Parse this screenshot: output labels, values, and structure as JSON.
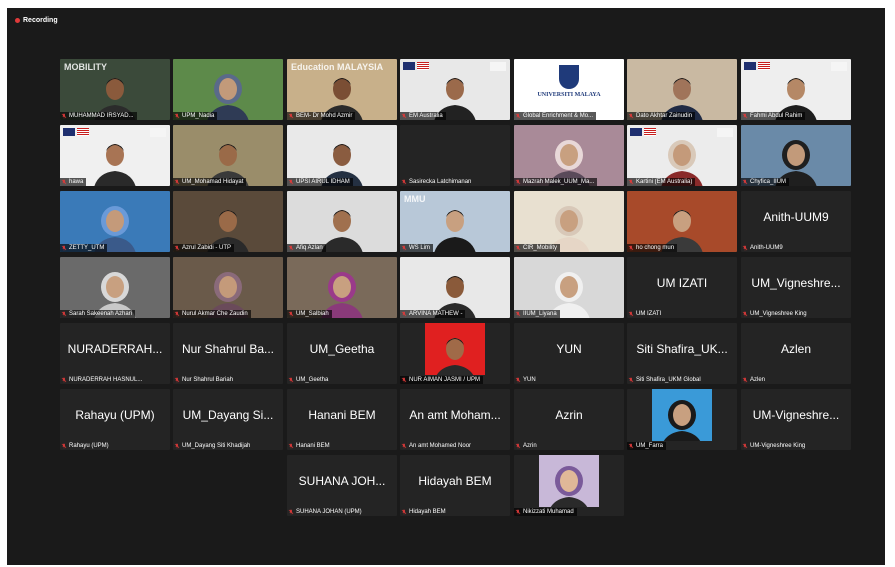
{
  "recording": {
    "label": "Recording",
    "color": "#e03a3a"
  },
  "colors": {
    "window_bg": "#1a1a1a",
    "tile_bg": "#242424",
    "muted_mic": "#e03a3a"
  },
  "participants": [
    {
      "name": "MUHAMMAD IRSYAD...",
      "display": "",
      "row": 0,
      "col": 0,
      "video": "banner",
      "bg": "#3b4a3a",
      "skin": "#8a5a3c",
      "shirt": "#2b2b2b",
      "icon": "pin-icon",
      "overlay": "MOBILITY"
    },
    {
      "name": "UPM_Nadia",
      "display": "",
      "row": 0,
      "col": 1,
      "video": "cam",
      "bg": "#5d8a4a",
      "skin": "#c29a7a",
      "shirt": "#2f3b55",
      "scarf": "#5a6a8a"
    },
    {
      "name": "BEM- Dr Mohd Azmir",
      "display": "",
      "row": 0,
      "col": 2,
      "video": "banner",
      "bg": "#c8b08a",
      "skin": "#7a4e34",
      "shirt": "#2a2a2a",
      "overlay": "Education MALAYSIA"
    },
    {
      "name": "EM Australia",
      "display": "",
      "row": 0,
      "col": 3,
      "video": "cam",
      "bg": "#e8e8e8",
      "skin": "#9b6a4b",
      "shirt": "#222222",
      "flags": true
    },
    {
      "name": "Global Enrichment & Mo...",
      "display": "",
      "row": 0,
      "col": 4,
      "video": "logo",
      "bg": "#ffffff",
      "overlay": "UNIVERSITI MALAYA"
    },
    {
      "name": "Dato Akhtar Zainudin",
      "display": "",
      "row": 0,
      "col": 5,
      "video": "cam",
      "bg": "#c9b9a2",
      "skin": "#a0745a",
      "shirt": "#1f2a44"
    },
    {
      "name": "Fahmi Abdul Rahim",
      "display": "",
      "row": 0,
      "col": 6,
      "video": "cam",
      "bg": "#eeeeee",
      "skin": "#b58866",
      "shirt": "#1d1d1d",
      "flags": true
    },
    {
      "name": "hawa",
      "display": "",
      "row": 1,
      "col": 0,
      "video": "cam",
      "bg": "#f0f0f0",
      "skin": "#a87454",
      "shirt": "#2a2a2a",
      "flags": true
    },
    {
      "name": "UM_Mohamad Hidayat",
      "display": "",
      "row": 1,
      "col": 1,
      "video": "cam",
      "bg": "#9a8d6a",
      "skin": "#9a6a48",
      "shirt": "#3a3a3a"
    },
    {
      "name": "UPSI AIRUL IDHAM",
      "display": "",
      "row": 1,
      "col": 2,
      "video": "cam",
      "bg": "#e9e9e9",
      "skin": "#8a5c40",
      "shirt": "#243042"
    },
    {
      "name": "Sasirecka Latchimanan",
      "display": "",
      "row": 1,
      "col": 3,
      "video": "off",
      "bg": "#181818"
    },
    {
      "name": "Mazrah Malek_UUM_Ma...",
      "display": "",
      "row": 1,
      "col": 4,
      "video": "cam",
      "bg": "#a98a98",
      "skin": "#c8a080",
      "shirt": "#5a4a5a",
      "scarf": "#e8d8d8"
    },
    {
      "name": "Kartini (EM Australia)",
      "display": "",
      "row": 1,
      "col": 5,
      "video": "cam",
      "bg": "#ececec",
      "skin": "#c49a7a",
      "shirt": "#8a2a2a",
      "scarf": "#d9c9b9",
      "flags": true
    },
    {
      "name": "Chyfica_IIUM",
      "display": "",
      "row": 1,
      "col": 6,
      "video": "cam",
      "bg": "#6a8aa8",
      "skin": "#c29a7a",
      "shirt": "#1f1f1f",
      "scarf": "#1f1f1f"
    },
    {
      "name": "ZETTY_UTM",
      "display": "",
      "row": 2,
      "col": 0,
      "video": "cam",
      "bg": "#3a7ab8",
      "skin": "#c49a7a",
      "shirt": "#3a5a8a",
      "scarf": "#6a9ad8"
    },
    {
      "name": "Azrul Zabidi - UTP",
      "display": "",
      "row": 2,
      "col": 1,
      "video": "cam",
      "bg": "#5a4a3a",
      "skin": "#9a6a48",
      "shirt": "#2a2a2a"
    },
    {
      "name": "Afiq Azlan",
      "display": "",
      "row": 2,
      "col": 2,
      "video": "cam",
      "bg": "#dcdcdc",
      "skin": "#a0704e",
      "shirt": "#2a2a2a"
    },
    {
      "name": "WS Lim",
      "display": "",
      "row": 2,
      "col": 3,
      "video": "banner",
      "bg": "#b8c8d8",
      "skin": "#c8a080",
      "shirt": "#1a1a1a",
      "overlay": "MMU"
    },
    {
      "name": "CIR_Mobility",
      "display": "",
      "row": 2,
      "col": 4,
      "video": "cam",
      "bg": "#e8e0d0",
      "skin": "#c8a080",
      "shirt": "#e6d6c6",
      "scarf": "#d8c8b8"
    },
    {
      "name": "ho chong mun",
      "display": "",
      "row": 2,
      "col": 5,
      "video": "cam",
      "bg": "#a84a2a",
      "skin": "#c8a080",
      "shirt": "#3a3a3a"
    },
    {
      "name": "Anith-UUM9",
      "display": "Anith-UUM9",
      "row": 2,
      "col": 6,
      "video": "off",
      "bg": "#242424"
    },
    {
      "name": "Sarah Sakeenah Azhari",
      "display": "",
      "row": 3,
      "col": 0,
      "video": "cam",
      "bg": "#6a6a6a",
      "skin": "#c8a080",
      "shirt": "#c8c8c8",
      "scarf": "#d8d8d8"
    },
    {
      "name": "Nurul Akmar Che Zaudin",
      "display": "",
      "row": 3,
      "col": 1,
      "video": "cam",
      "bg": "#6a5a4a",
      "skin": "#c49a7a",
      "shirt": "#6a4a5a",
      "scarf": "#8a6a7a"
    },
    {
      "name": "UM_Salbiah",
      "display": "",
      "row": 3,
      "col": 2,
      "video": "cam",
      "bg": "#7a6a5a",
      "skin": "#c8a080",
      "shirt": "#8a3a7a",
      "scarf": "#9a3a8a"
    },
    {
      "name": "ARVINA MATHEW -",
      "display": "",
      "row": 3,
      "col": 3,
      "video": "banner",
      "bg": "#e8e8e8",
      "skin": "#8a5a3a",
      "shirt": "#2a2a2a",
      "overlay": ""
    },
    {
      "name": "IIUM_Liyana",
      "display": "",
      "row": 3,
      "col": 4,
      "video": "cam",
      "bg": "#d8d8d8",
      "skin": "#c8a080",
      "shirt": "#f0f0f0",
      "scarf": "#f0f0f0"
    },
    {
      "name": "UM IZATI",
      "display": "UM IZATI",
      "row": 3,
      "col": 5,
      "video": "off",
      "bg": "#242424"
    },
    {
      "name": "UM_Vigneshree King",
      "display": "UM_Vigneshre...",
      "row": 3,
      "col": 6,
      "video": "off",
      "bg": "#242424"
    },
    {
      "name": "NURADERRAH HASNUL...",
      "display": "NURADERRAH...",
      "row": 4,
      "col": 0,
      "video": "off",
      "bg": "#242424"
    },
    {
      "name": "Nur Shahrul Bariah",
      "display": "Nur Shahrul Ba...",
      "row": 4,
      "col": 1,
      "video": "off",
      "bg": "#242424"
    },
    {
      "name": "UM_Geetha",
      "display": "UM_Geetha",
      "row": 4,
      "col": 2,
      "video": "off",
      "bg": "#242424"
    },
    {
      "name": "NUR AIMAN JASMI / UPM",
      "display": "",
      "row": 4,
      "col": 3,
      "video": "photo",
      "bg": "#e02020",
      "skin": "#a06a48",
      "shirt": "#2a2a2a"
    },
    {
      "name": "YUN",
      "display": "YUN",
      "row": 4,
      "col": 4,
      "video": "off",
      "bg": "#242424"
    },
    {
      "name": "Siti Shafira_UKM Global",
      "display": "Siti Shafira_UK...",
      "row": 4,
      "col": 5,
      "video": "off",
      "bg": "#242424"
    },
    {
      "name": "Azlen",
      "display": "Azlen",
      "row": 4,
      "col": 6,
      "video": "off",
      "bg": "#242424"
    },
    {
      "name": "Rahayu (UPM)",
      "display": "Rahayu (UPM)",
      "row": 5,
      "col": 0,
      "video": "off",
      "bg": "#242424"
    },
    {
      "name": "UM_Dayang Siti Khadijah",
      "display": "UM_Dayang Si...",
      "row": 5,
      "col": 1,
      "video": "off",
      "bg": "#242424"
    },
    {
      "name": "Hanani BEM",
      "display": "Hanani BEM",
      "row": 5,
      "col": 2,
      "video": "off",
      "bg": "#242424"
    },
    {
      "name": "An amt Mohamed Noor",
      "display": "An amt Moham...",
      "row": 5,
      "col": 3,
      "video": "off",
      "bg": "#242424"
    },
    {
      "name": "Azrin",
      "display": "Azrin",
      "row": 5,
      "col": 4,
      "video": "off",
      "bg": "#242424"
    },
    {
      "name": "UM_Farra",
      "display": "",
      "row": 5,
      "col": 5,
      "video": "photo",
      "bg": "#3a9ad8",
      "skin": "#c8a080",
      "shirt": "#1a1a1a",
      "scarf": "#1a1a1a"
    },
    {
      "name": "UM-Vigneshree King",
      "display": "UM-Vigneshre...",
      "row": 5,
      "col": 6,
      "video": "off",
      "bg": "#242424"
    },
    {
      "name": "SUHANA JOHAN (UPM)",
      "display": "SUHANA JOH...",
      "row": 6,
      "col": 2,
      "video": "off",
      "bg": "#242424"
    },
    {
      "name": "Hidayah BEM",
      "display": "Hidayah BEM",
      "row": 6,
      "col": 3,
      "video": "off",
      "bg": "#242424"
    },
    {
      "name": "Nikizzati Muhamad",
      "display": "",
      "row": 6,
      "col": 4,
      "video": "photo",
      "bg": "#c8b8d8",
      "skin": "#e0b898",
      "shirt": "#2a2a2a",
      "scarf": "#7a5a9a"
    }
  ]
}
